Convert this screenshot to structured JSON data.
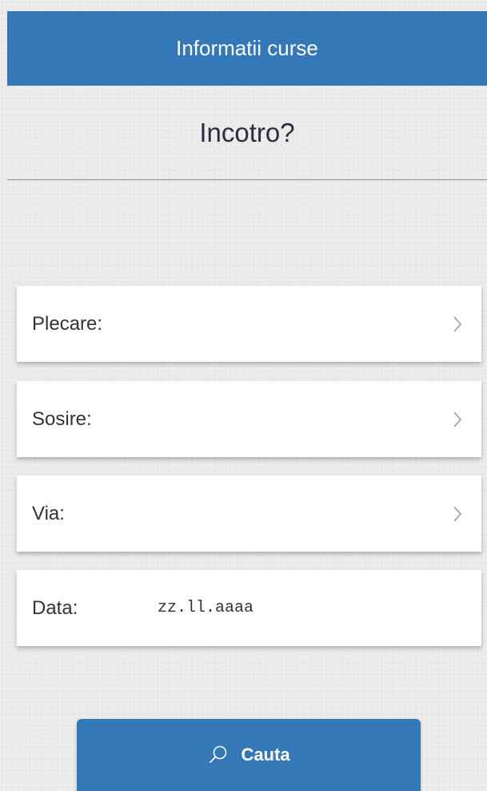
{
  "header": {
    "title": "Informatii curse"
  },
  "main": {
    "question": "Incotro?",
    "fields": [
      {
        "label": "Plecare:",
        "icon": "chevron-right-icon"
      },
      {
        "label": "Sosire:",
        "icon": "chevron-right-icon"
      },
      {
        "label": "Via:",
        "icon": "chevron-right-icon"
      }
    ],
    "date": {
      "label": "Data:",
      "placeholder": "zz.ll.aaaa",
      "value": ""
    }
  },
  "search_button": {
    "label": "Cauta",
    "icon": "search-icon"
  },
  "colors": {
    "accent": "#3478b7",
    "background": "#ebebeb",
    "card": "#ffffff",
    "text": "#333333"
  }
}
